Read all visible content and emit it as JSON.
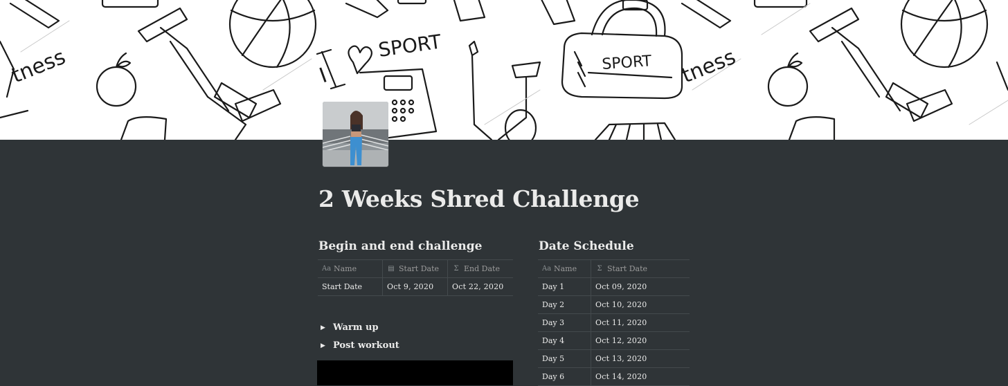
{
  "page": {
    "title": "2 Weeks Shred Challenge",
    "cover_description": "hand-drawn sport doodle pattern",
    "cover_text": [
      "I",
      "SPORT",
      "SPORT",
      "tness",
      "tness"
    ]
  },
  "begin_end_table": {
    "heading": "Begin and end challenge",
    "columns": [
      {
        "label": "Name",
        "icon": "text-property-icon"
      },
      {
        "label": "Start Date",
        "icon": "calendar-icon"
      },
      {
        "label": "End Date",
        "icon": "formula-icon"
      }
    ],
    "rows": [
      {
        "name": "Start Date",
        "start": "Oct 9, 2020",
        "end": "Oct 22, 2020"
      }
    ]
  },
  "toggles": [
    {
      "label": "Warm up"
    },
    {
      "label": "Post workout"
    }
  ],
  "schedule_table": {
    "heading": "Date Schedule",
    "columns": [
      {
        "label": "Name",
        "icon": "text-property-icon"
      },
      {
        "label": "Start Date",
        "icon": "formula-icon"
      }
    ],
    "rows": [
      {
        "name": "Day 1",
        "date": "Oct 09, 2020"
      },
      {
        "name": "Day 2",
        "date": "Oct 10, 2020"
      },
      {
        "name": "Day 3",
        "date": "Oct 11, 2020"
      },
      {
        "name": "Day 4",
        "date": "Oct 12, 2020"
      },
      {
        "name": "Day 5",
        "date": "Oct 13, 2020"
      },
      {
        "name": "Day 6",
        "date": "Oct 14, 2020"
      }
    ]
  },
  "colors": {
    "background": "#2f3437",
    "text": "#ebebea",
    "muted": "#9b9b9b",
    "divider": "#444a4d",
    "cover": "#ffffff"
  }
}
